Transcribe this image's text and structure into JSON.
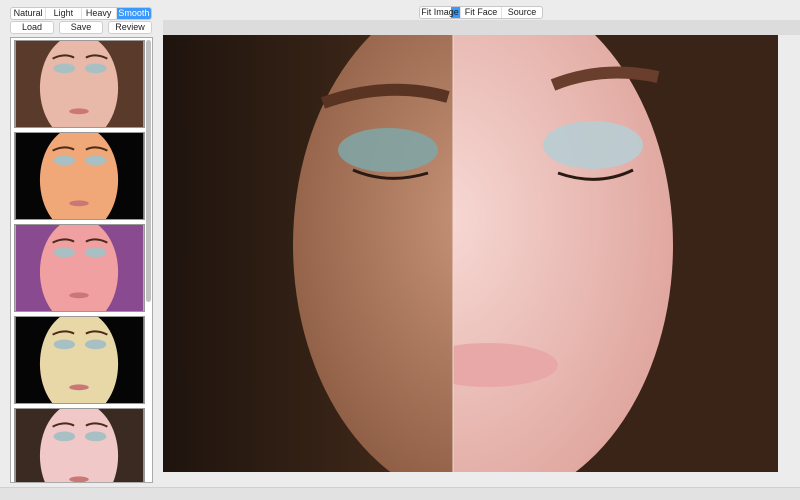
{
  "presets": {
    "items": [
      "Natural",
      "Light",
      "Heavy",
      "Smooth"
    ],
    "selected": "Smooth"
  },
  "actions": {
    "load": "Load",
    "save": "Save",
    "review": "Review"
  },
  "view": {
    "items": [
      "Fit Image",
      "Fit Face",
      "Source"
    ],
    "selected": "Fit Image"
  },
  "thumbnails": [
    {
      "name": "natural",
      "tint": "#e8b8a8",
      "bg": "#5a3a2a"
    },
    {
      "name": "warm-contrast",
      "tint": "#f0a878",
      "bg": "#050505"
    },
    {
      "name": "purple",
      "tint": "#f0a0a0",
      "bg": "#8a4a90"
    },
    {
      "name": "gold",
      "tint": "#e8d8a8",
      "bg": "#050505"
    },
    {
      "name": "soft",
      "tint": "#f0c8c8",
      "bg": "#3a2a22"
    }
  ],
  "colors": {
    "accent": "#3b99fc",
    "background": "#ececec"
  }
}
